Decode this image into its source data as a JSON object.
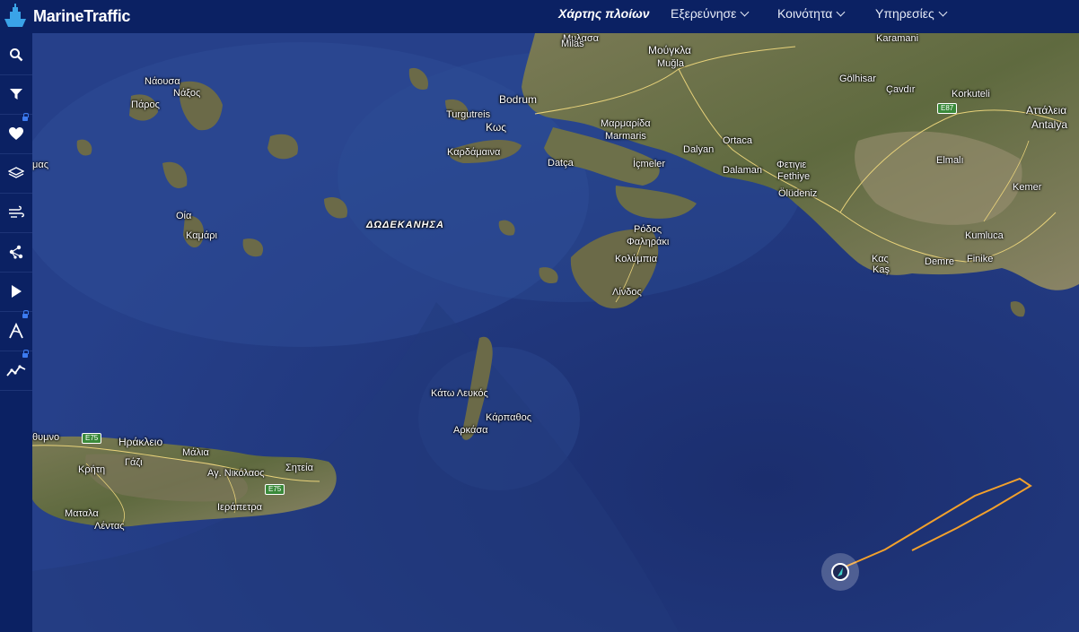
{
  "header": {
    "brand": "MarineTraffic",
    "nav": [
      {
        "label": "Χάρτης πλοίων",
        "dropdown": false,
        "active": true
      },
      {
        "label": "Εξερεύνησε",
        "dropdown": true,
        "active": false
      },
      {
        "label": "Κοινότητα",
        "dropdown": true,
        "active": false
      },
      {
        "label": "Υπηρεσίες",
        "dropdown": true,
        "active": false
      }
    ]
  },
  "sidebar": {
    "items": [
      {
        "icon": "search-icon",
        "locked": false
      },
      {
        "icon": "filter-icon",
        "locked": false
      },
      {
        "icon": "heart-icon",
        "locked": true
      },
      {
        "icon": "layers-icon",
        "locked": false
      },
      {
        "icon": "weather-icon",
        "locked": false
      },
      {
        "icon": "density-icon",
        "locked": false
      },
      {
        "icon": "play-icon",
        "locked": false
      },
      {
        "icon": "routes-icon",
        "locked": true
      },
      {
        "icon": "analytics-icon",
        "locked": true
      }
    ]
  },
  "map": {
    "colors": {
      "sea": "#1f3578",
      "land": "#6b6a48",
      "track": "#f3a12c"
    },
    "labels": {
      "naousa": "Νάουσα",
      "naxos": "Νάξος",
      "paros": "Πάρος",
      "amas": "μας",
      "oia": "Οία",
      "kamari": "Καμάρι",
      "milas": "Milas",
      "mylasa": "Μυλασα",
      "mougla": "Μούγκλα",
      "mugla": "Muğla",
      "bodrum": "Bodrum",
      "turgutreis": "Turgutreis",
      "kos": "Κως",
      "kardamaina": "Καρδάμαινα",
      "marmaris_gr": "Μαρμαρίδα",
      "marmaris": "Marmaris",
      "dalyan": "Dalyan",
      "ortaca": "Ortaca",
      "dalaman": "Dalaman",
      "fetiye": "Φετιγιε",
      "fethiye": "Fethiye",
      "oludeniz": "Ölüdeniz",
      "datca": "Datça",
      "icmeler": "İçmeler",
      "dodecanese": "ΔΩΔΕΚΑΝΗΣΑ",
      "rodos": "Ρόδος",
      "faliraki": "Φαληράκι",
      "kolympia": "Κολύμπια",
      "lindos": "Λίνδος",
      "golhisar": "Gölhisar",
      "cavdir": "Çavdır",
      "korkuteli": "Korkuteli",
      "attaleia": "Αττάλεια",
      "antalya": "Antalya",
      "elmali": "Elmalı",
      "kemer": "Kemer",
      "kumluca": "Kumluca",
      "finike": "Finike",
      "demre": "Demre",
      "kas_gr": "Κας",
      "kas": "Kaş",
      "karamani": "Karamani",
      "kato_lefkos": "Κάτω Λευκός",
      "karpathos": "Κάρπαθος",
      "arkasa": "Αρκάσα",
      "rethymno": "θυμνο",
      "irakleio": "Ηράκλειο",
      "malia": "Μάλια",
      "gazi": "Γάζι",
      "kriti": "Κρήτη",
      "ag_nikolaos": "Αγ. Νικόλαος",
      "siteia": "Σητεία",
      "ierapetra": "Ιεράπετρα",
      "matala": "Ματαλα",
      "lentas": "Λέντας",
      "e75_a": "E75",
      "e75_b": "E75",
      "e87": "E87"
    }
  }
}
